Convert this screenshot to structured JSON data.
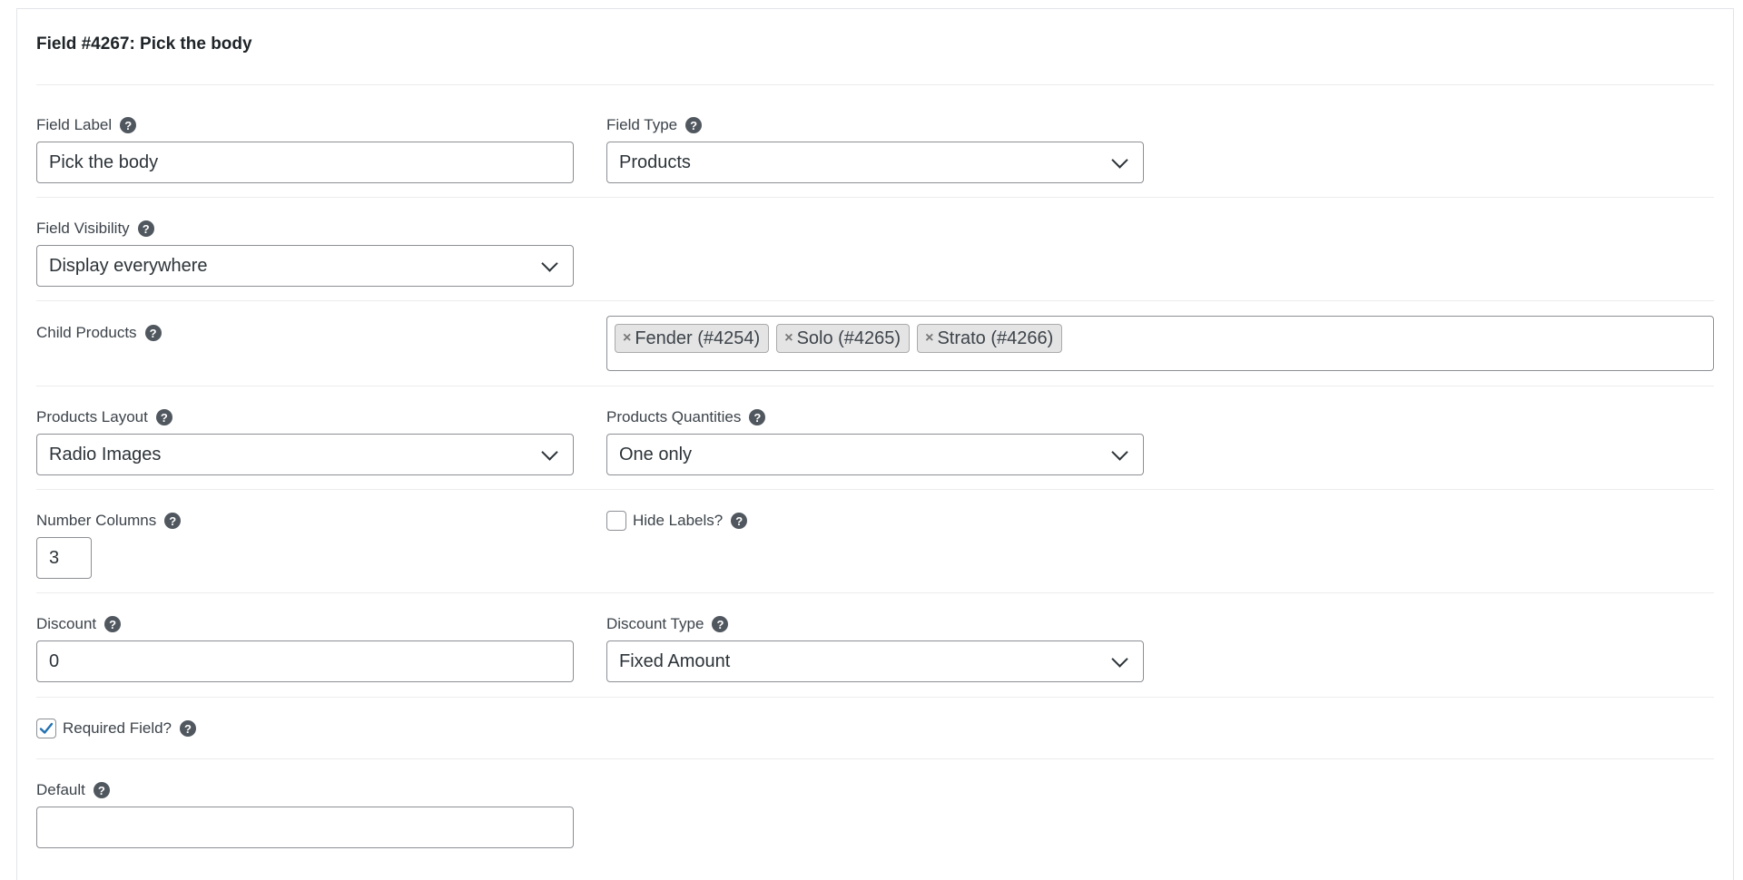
{
  "field": {
    "title": "Field #4267: Pick the body"
  },
  "field_label": {
    "label": "Field Label",
    "value": "Pick the body"
  },
  "field_type": {
    "label": "Field Type",
    "selected": "Products"
  },
  "field_visibility": {
    "label": "Field Visibility",
    "selected": "Display everywhere"
  },
  "child_products": {
    "label": "Child Products",
    "tags": [
      {
        "remove": "×",
        "label": "Fender (#4254)"
      },
      {
        "remove": "×",
        "label": "Solo (#4265)"
      },
      {
        "remove": "×",
        "label": "Strato (#4266)"
      }
    ]
  },
  "products_layout": {
    "label": "Products Layout",
    "selected": "Radio Images"
  },
  "products_quantities": {
    "label": "Products Quantities",
    "selected": "One only"
  },
  "number_columns": {
    "label": "Number Columns",
    "value": "3"
  },
  "hide_labels": {
    "label": "Hide Labels?",
    "checked": false
  },
  "discount": {
    "label": "Discount",
    "value": "0"
  },
  "discount_type": {
    "label": "Discount Type",
    "selected": "Fixed Amount"
  },
  "required_field": {
    "label": "Required Field?",
    "checked": true
  },
  "default_field": {
    "label": "Default",
    "value": ""
  },
  "help": {
    "glyph": "?"
  },
  "colors": {
    "check_accent": "#2271b1",
    "help_icon_bg": "#50575e",
    "border": "#8c8f94"
  }
}
